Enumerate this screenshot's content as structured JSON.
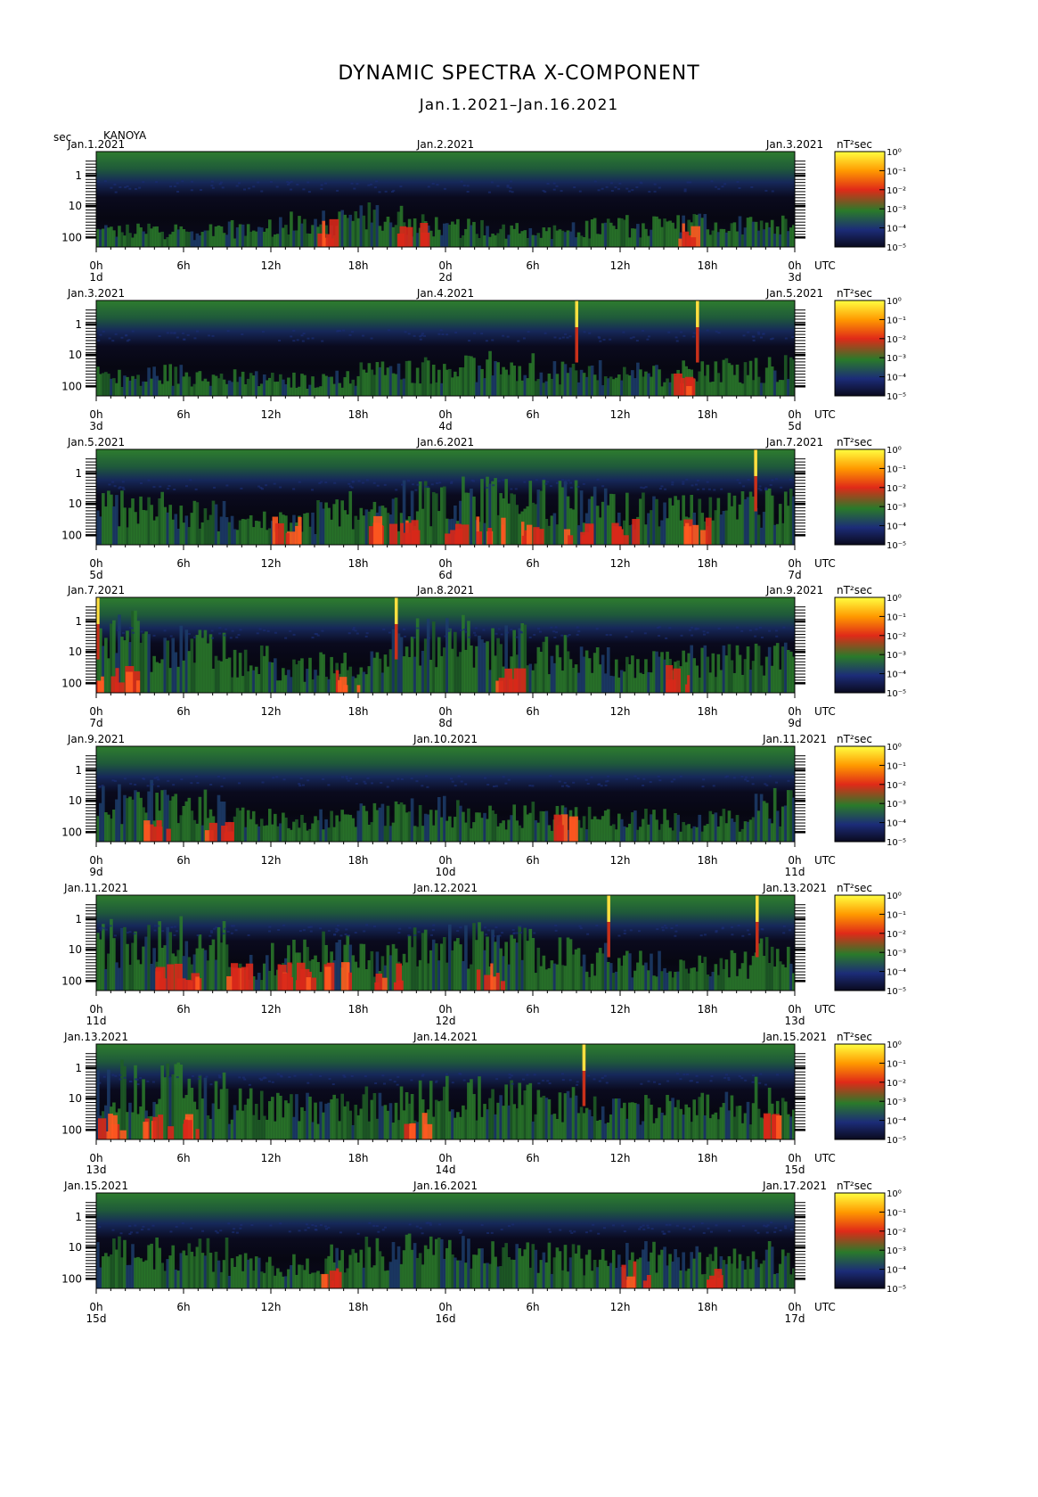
{
  "header": {
    "title": "DYNAMIC SPECTRA X-COMPONENT",
    "subtitle": "Jan.1.2021–Jan.16.2021",
    "y_unit": "sec",
    "station": "KANOYA"
  },
  "chart_data": {
    "type": "heatmap",
    "title": "DYNAMIC SPECTRA X-COMPONENT",
    "subtitle": "Jan.1.2021–Jan.16.2021",
    "station": "KANOYA",
    "ylabel": "sec",
    "y_ticks": [
      "1",
      "10",
      "100"
    ],
    "y_scale": "log",
    "x_ticks": [
      "0h",
      "6h",
      "12h",
      "18h",
      "0h",
      "6h",
      "12h",
      "18h",
      "0h"
    ],
    "x_unit": "UTC",
    "colorbar_unit": "nT²sec",
    "colorbar_ticks": [
      "10⁰",
      "10⁻¹",
      "10⁻²",
      "10⁻³",
      "10⁻⁴",
      "10⁻⁵"
    ],
    "colorscale": [
      "#0a0a1e",
      "#1c2c78",
      "#2a7a2a",
      "#e02a18",
      "#ff9a00",
      "#ffff40"
    ],
    "panels": [
      {
        "date_left": "Jan.1.2021",
        "date_mid": "Jan.2.2021",
        "date_right": "Jan.3.2021",
        "day_left": "1d",
        "day_mid": "2d",
        "day_right": "3d",
        "activity": [
          0.2,
          0.22,
          0.2,
          0.25,
          0.3,
          0.32,
          0.4,
          0.28,
          0.25,
          0.24,
          0.22,
          0.25,
          0.28,
          0.3,
          0.26,
          0.28
        ],
        "red_hours": [
          15.5,
          21.5,
          40.0
        ],
        "spikes_hours": []
      },
      {
        "date_left": "Jan.3.2021",
        "date_mid": "Jan.4.2021",
        "date_right": "Jan.5.2021",
        "day_left": "3d",
        "day_mid": "4d",
        "day_right": "5d",
        "activity": [
          0.25,
          0.28,
          0.22,
          0.24,
          0.2,
          0.22,
          0.3,
          0.35,
          0.38,
          0.36,
          0.34,
          0.3,
          0.28,
          0.3,
          0.32,
          0.35
        ],
        "red_hours": [
          40.0
        ],
        "spikes_hours": [
          33.0,
          41.3
        ]
      },
      {
        "date_left": "Jan.5.2021",
        "date_mid": "Jan.6.2021",
        "date_right": "Jan.7.2021",
        "day_left": "5d",
        "day_mid": "6d",
        "day_right": "7d",
        "activity": [
          0.5,
          0.45,
          0.4,
          0.3,
          0.3,
          0.45,
          0.4,
          0.55,
          0.6,
          0.58,
          0.55,
          0.5,
          0.45,
          0.42,
          0.45,
          0.48
        ],
        "red_hours": [
          13.0,
          19.5,
          21.0,
          24.5,
          27.0,
          30.0,
          33.0,
          36.0,
          41.0
        ],
        "spikes_hours": [
          45.3
        ]
      },
      {
        "date_left": "Jan.7.2021",
        "date_mid": "Jan.8.2021",
        "date_right": "Jan.9.2021",
        "day_left": "7d",
        "day_mid": "8d",
        "day_right": "9d",
        "activity": [
          0.7,
          0.6,
          0.55,
          0.4,
          0.3,
          0.35,
          0.55,
          0.65,
          0.68,
          0.6,
          0.5,
          0.4,
          0.35,
          0.4,
          0.42,
          0.45
        ],
        "red_hours": [
          0.5,
          2.0,
          17.0,
          28.0,
          40.0
        ],
        "spikes_hours": [
          0.1,
          20.6
        ]
      },
      {
        "date_left": "Jan.9.2021",
        "date_mid": "Jan.10.2021",
        "date_right": "Jan.11.2021",
        "day_left": "9d",
        "day_mid": "10d",
        "day_right": "11d",
        "activity": [
          0.5,
          0.55,
          0.45,
          0.3,
          0.25,
          0.28,
          0.35,
          0.4,
          0.38,
          0.35,
          0.32,
          0.3,
          0.28,
          0.25,
          0.28,
          0.45
        ],
        "red_hours": [
          4.0,
          8.0,
          32.0
        ],
        "spikes_hours": []
      },
      {
        "date_left": "Jan.11.2021",
        "date_mid": "Jan.12.2021",
        "date_right": "Jan.13.2021",
        "day_left": "11d",
        "day_mid": "12d",
        "day_right": "13d",
        "activity": [
          0.6,
          0.65,
          0.6,
          0.3,
          0.45,
          0.5,
          0.4,
          0.55,
          0.6,
          0.55,
          0.45,
          0.4,
          0.35,
          0.3,
          0.35,
          0.45
        ],
        "red_hours": [
          4.5,
          6.0,
          9.5,
          13.0,
          14.0,
          16.5,
          20.0,
          27.0
        ],
        "spikes_hours": [
          35.2,
          45.4
        ]
      },
      {
        "date_left": "Jan.13.2021",
        "date_mid": "Jan.14.2021",
        "date_right": "Jan.15.2021",
        "day_left": "13d",
        "day_mid": "14d",
        "day_right": "15d",
        "activity": [
          0.7,
          0.65,
          0.6,
          0.45,
          0.4,
          0.4,
          0.45,
          0.5,
          0.55,
          0.5,
          0.45,
          0.4,
          0.38,
          0.4,
          0.45,
          0.55
        ],
        "red_hours": [
          1.0,
          4.0,
          6.5,
          22.0,
          46.0
        ],
        "spikes_hours": [
          33.5
        ]
      },
      {
        "date_left": "Jan.15.2021",
        "date_mid": "Jan.16.2021",
        "date_right": "Jan.17.2021",
        "day_left": "15d",
        "day_mid": "16d",
        "day_right": "17d",
        "activity": [
          0.45,
          0.5,
          0.45,
          0.3,
          0.3,
          0.4,
          0.45,
          0.5,
          0.48,
          0.45,
          0.4,
          0.38,
          0.4,
          0.38,
          0.35,
          0.4
        ],
        "red_hours": [
          16.0,
          37.0,
          42.0
        ],
        "spikes_hours": []
      }
    ]
  }
}
